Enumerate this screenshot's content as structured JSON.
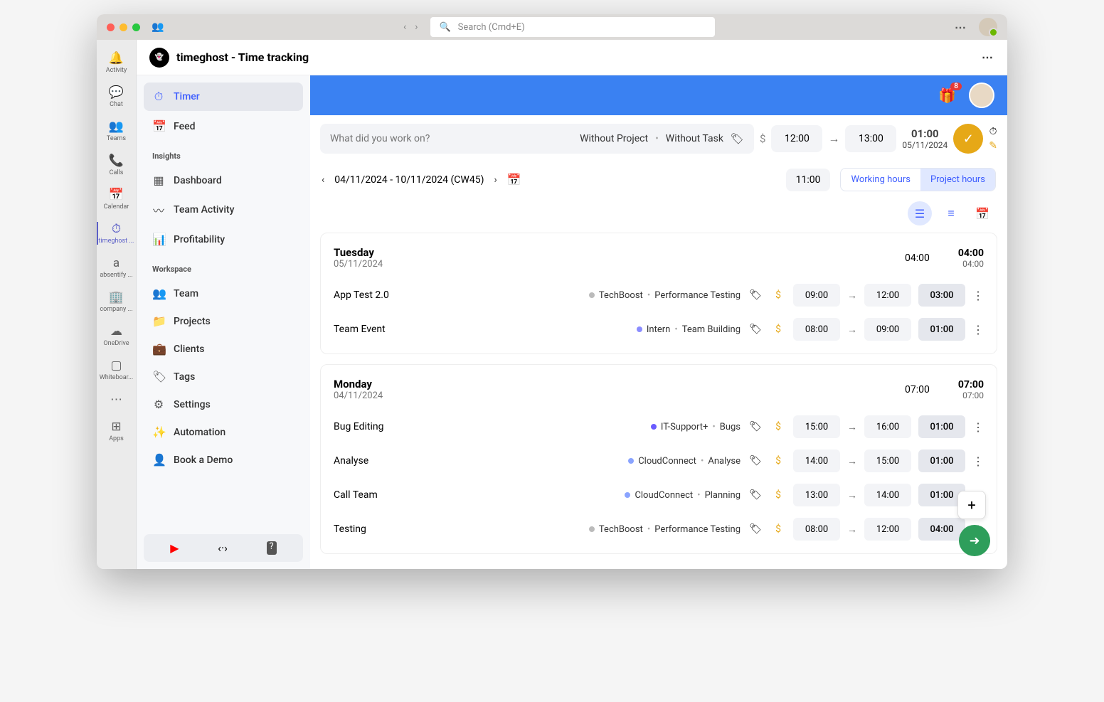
{
  "chrome": {
    "search_placeholder": "Search (Cmd+E)"
  },
  "rail": {
    "items": [
      {
        "icon": "🔔",
        "label": "Activity"
      },
      {
        "icon": "💬",
        "label": "Chat"
      },
      {
        "icon": "👥",
        "label": "Teams"
      },
      {
        "icon": "📞",
        "label": "Calls"
      },
      {
        "icon": "📅",
        "label": "Calendar"
      },
      {
        "icon": "⏱",
        "label": "timeghost ..."
      },
      {
        "icon": "a",
        "label": "absentify ..."
      },
      {
        "icon": "🏢",
        "label": "company ..."
      },
      {
        "icon": "☁",
        "label": "OneDrive"
      },
      {
        "icon": "▢",
        "label": "Whiteboar..."
      },
      {
        "icon": "⋯",
        "label": ""
      },
      {
        "icon": "⊞",
        "label": "Apps"
      }
    ],
    "active_index": 5
  },
  "app": {
    "title": "timeghost - Time tracking"
  },
  "sidebar": {
    "primary": [
      {
        "icon": "⏱",
        "label": "Timer"
      },
      {
        "icon": "📅",
        "label": "Feed"
      }
    ],
    "insights_header": "Insights",
    "insights": [
      {
        "icon": "▦",
        "label": "Dashboard"
      },
      {
        "icon": "〰",
        "label": "Team Activity"
      },
      {
        "icon": "📊",
        "label": "Profitability"
      }
    ],
    "workspace_header": "Workspace",
    "workspace": [
      {
        "icon": "👥",
        "label": "Team"
      },
      {
        "icon": "📁",
        "label": "Projects"
      },
      {
        "icon": "💼",
        "label": "Clients"
      },
      {
        "icon": "🏷",
        "label": "Tags"
      },
      {
        "icon": "⚙",
        "label": "Settings"
      },
      {
        "icon": "✨",
        "label": "Automation"
      },
      {
        "icon": "👤",
        "label": "Book a Demo"
      }
    ]
  },
  "bluebar": {
    "badge": "8"
  },
  "entry": {
    "placeholder": "What did you work on?",
    "project": "Without Project",
    "task": "Without Task",
    "start": "12:00",
    "end": "13:00",
    "duration": "01:00",
    "date": "05/11/2024"
  },
  "range": {
    "text": "04/11/2024 - 10/11/2024 (CW45)",
    "total": "11:00",
    "tab1": "Working hours",
    "tab2": "Project hours"
  },
  "days": [
    {
      "name": "Tuesday",
      "date": "05/11/2024",
      "sum1": "04:00",
      "sum2": "04:00",
      "sum2b": "04:00",
      "entries": [
        {
          "name": "App Test 2.0",
          "dotcolor": "#bbb",
          "proj": "TechBoost",
          "task": "Performance Testing",
          "start": "09:00",
          "end": "12:00",
          "dur": "03:00"
        },
        {
          "name": "Team Event",
          "dotcolor": "#8a8cff",
          "proj": "Intern",
          "task": "Team Building",
          "start": "08:00",
          "end": "09:00",
          "dur": "01:00"
        }
      ]
    },
    {
      "name": "Monday",
      "date": "04/11/2024",
      "sum1": "07:00",
      "sum2": "07:00",
      "sum2b": "07:00",
      "entries": [
        {
          "name": "Bug Editing",
          "dotcolor": "#6a5cff",
          "proj": "IT-Support+",
          "task": "Bugs",
          "start": "15:00",
          "end": "16:00",
          "dur": "01:00"
        },
        {
          "name": "Analyse",
          "dotcolor": "#8aa4ff",
          "proj": "CloudConnect",
          "task": "Analyse",
          "start": "14:00",
          "end": "15:00",
          "dur": "01:00"
        },
        {
          "name": "Call Team",
          "dotcolor": "#8aa4ff",
          "proj": "CloudConnect",
          "task": "Planning",
          "start": "13:00",
          "end": "14:00",
          "dur": "01:00"
        },
        {
          "name": "Testing",
          "dotcolor": "#bbb",
          "proj": "TechBoost",
          "task": "Performance Testing",
          "start": "08:00",
          "end": "12:00",
          "dur": "04:00"
        }
      ]
    }
  ]
}
